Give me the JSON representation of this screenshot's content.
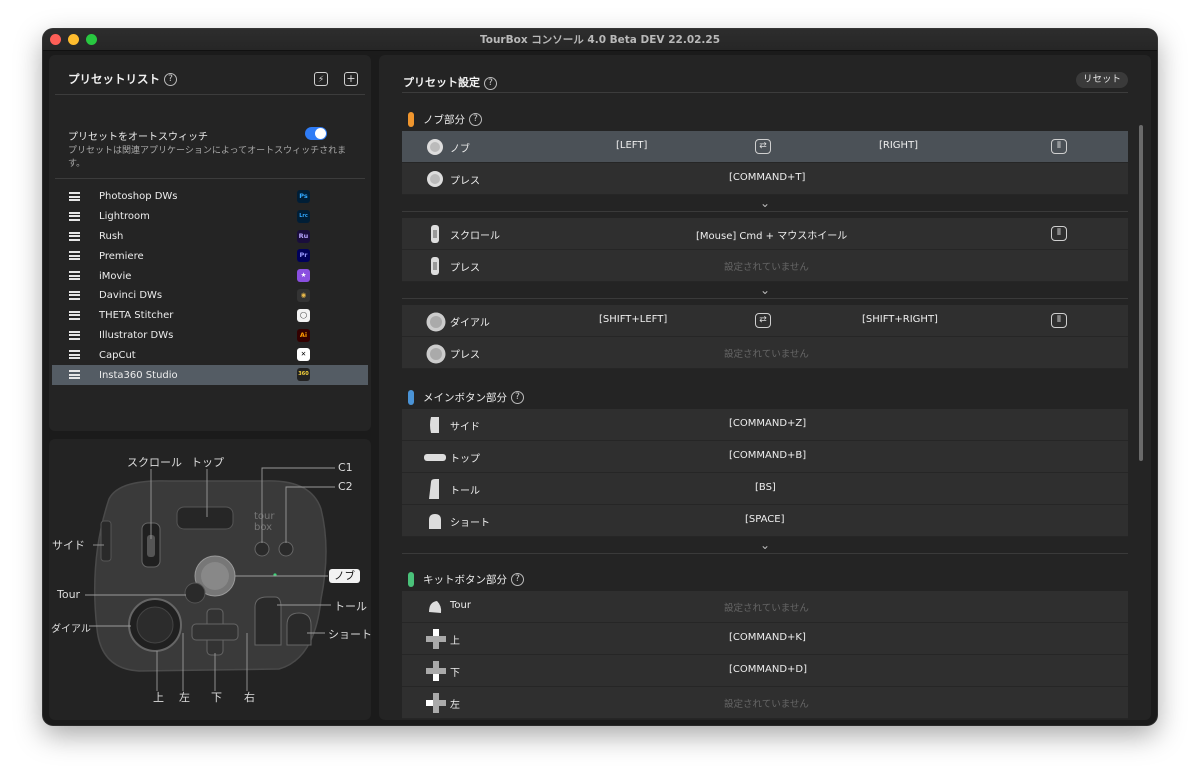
{
  "window": {
    "title": "TourBox コンソール 4.0 Beta DEV 22.02.25"
  },
  "preset_list": {
    "title": "プリセットリスト",
    "auto_switch_label": "プリセットをオートスウィッチ",
    "auto_switch_on": true,
    "auto_switch_desc": "プリセットは関連アプリケーションによってオートスウィッチされます。",
    "items": [
      {
        "name": "Photoshop DWs",
        "icon": "Ps",
        "color": "#31a8ff",
        "bg": "#001e36"
      },
      {
        "name": "Lightroom",
        "icon": "Lrc",
        "color": "#31a8ff",
        "bg": "#001e36"
      },
      {
        "name": "Rush",
        "icon": "Ru",
        "color": "#b9a6ff",
        "bg": "#1a0e3c"
      },
      {
        "name": "Premiere",
        "icon": "Pr",
        "color": "#9999ff",
        "bg": "#00005b"
      },
      {
        "name": "iMovie",
        "icon": "★",
        "color": "#ffffff",
        "bg": "#8a4fe0"
      },
      {
        "name": "Davinci DWs",
        "icon": "◉",
        "color": "#e8b84a",
        "bg": "#333333"
      },
      {
        "name": "THETA Stitcher",
        "icon": "◯",
        "color": "#333333",
        "bg": "#f2f2f2"
      },
      {
        "name": "Illustrator DWs",
        "icon": "Ai",
        "color": "#ff9a00",
        "bg": "#330000"
      },
      {
        "name": "CapCut",
        "icon": "✕",
        "color": "#000000",
        "bg": "#ffffff"
      },
      {
        "name": "Insta360 Studio",
        "icon": "360",
        "color": "#f6d33c",
        "bg": "#222222"
      }
    ],
    "selected_index": 9
  },
  "device": {
    "labels": {
      "scroll": "スクロール",
      "top": "トップ",
      "c1": "C1",
      "c2": "C2",
      "side": "サイド",
      "knob": "ノブ",
      "tour": "Tour",
      "tall": "トール",
      "dial": "ダイアル",
      "short": "ショート",
      "up": "上",
      "left": "左",
      "down": "下",
      "right": "右"
    }
  },
  "preset_settings": {
    "title": "プリセット設定",
    "reset_label": "リセット",
    "knob_section": {
      "title": "ノブ部分",
      "color": "#f0962e",
      "rows": [
        {
          "name": "ノブ",
          "left_value": "[LEFT]",
          "right_value": "[RIGHT]"
        },
        {
          "name": "プレス",
          "value": "[COMMAND+T]"
        }
      ],
      "scroll_rows": [
        {
          "name": "スクロール",
          "value": "[Mouse] Cmd + マウスホイール"
        },
        {
          "name": "プレス",
          "value": "設定されていません"
        }
      ],
      "dial_rows": [
        {
          "name": "ダイアル",
          "left_value": "[SHIFT+LEFT]",
          "right_value": "[SHIFT+RIGHT]"
        },
        {
          "name": "プレス",
          "value": "設定されていません"
        }
      ]
    },
    "main_section": {
      "title": "メインボタン部分",
      "color": "#4a93d6",
      "rows": [
        {
          "name": "サイド",
          "value": "[COMMAND+Z]"
        },
        {
          "name": "トップ",
          "value": "[COMMAND+B]"
        },
        {
          "name": "トール",
          "value": "[BS]"
        },
        {
          "name": "ショート",
          "value": "[SPACE]"
        }
      ]
    },
    "kit_section": {
      "title": "キットボタン部分",
      "color": "#4ac27a",
      "rows": [
        {
          "name": "Tour",
          "value": "設定されていません"
        },
        {
          "name": "上",
          "value": "[COMMAND+K]"
        },
        {
          "name": "下",
          "value": "[COMMAND+D]"
        },
        {
          "name": "左",
          "value": "設定されていません"
        }
      ]
    }
  }
}
